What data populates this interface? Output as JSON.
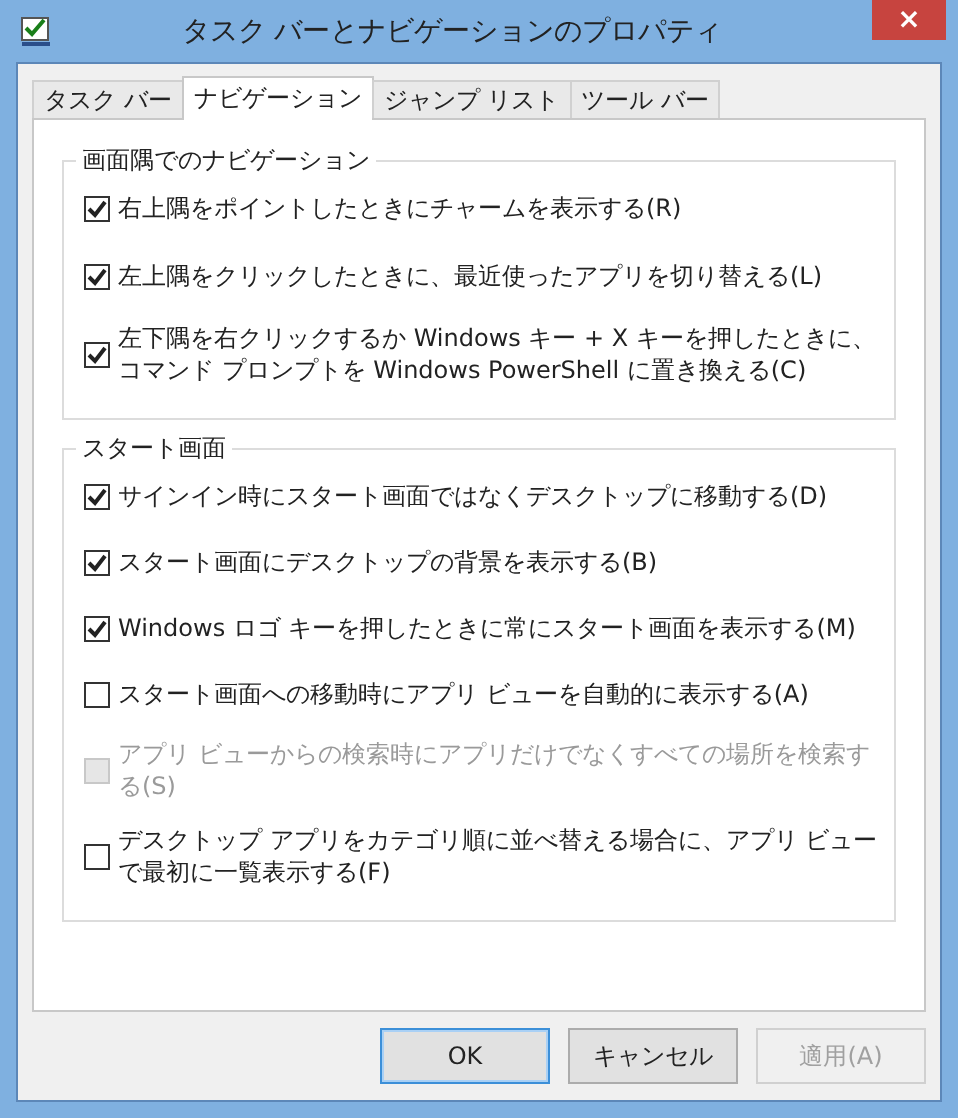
{
  "window": {
    "title": "タスク バーとナビゲーションのプロパティ",
    "close": "×"
  },
  "tabs": [
    {
      "label": "タスク バー",
      "selected": false
    },
    {
      "label": "ナビゲーション",
      "selected": true
    },
    {
      "label": "ジャンプ リスト",
      "selected": false
    },
    {
      "label": "ツール バー",
      "selected": false
    }
  ],
  "groups": [
    {
      "title": "画面隅でのナビゲーション",
      "options": [
        {
          "label": "右上隅をポイントしたときにチャームを表示する(R)",
          "checked": true,
          "disabled": false
        },
        {
          "label": "左上隅をクリックしたときに、最近使ったアプリを切り替える(L)",
          "checked": true,
          "disabled": false
        },
        {
          "label": "左下隅を右クリックするか Windows キー + X キーを押したときに、コマンド プロンプトを Windows PowerShell に置き換える(C)",
          "checked": true,
          "disabled": false
        }
      ]
    },
    {
      "title": "スタート画面",
      "options": [
        {
          "label": "サインイン時にスタート画面ではなくデスクトップに移動する(D)",
          "checked": true,
          "disabled": false
        },
        {
          "label": "スタート画面にデスクトップの背景を表示する(B)",
          "checked": true,
          "disabled": false
        },
        {
          "label": "Windows ロゴ キーを押したときに常にスタート画面を表示する(M)",
          "checked": true,
          "disabled": false
        },
        {
          "label": "スタート画面への移動時にアプリ ビューを自動的に表示する(A)",
          "checked": false,
          "disabled": false
        },
        {
          "label": "アプリ ビューからの検索時にアプリだけでなくすべての場所を検索する(S)",
          "checked": false,
          "disabled": true
        },
        {
          "label": "デスクトップ アプリをカテゴリ順に並べ替える場合に、アプリ ビューで最初に一覧表示する(F)",
          "checked": false,
          "disabled": false
        }
      ]
    }
  ],
  "buttons": [
    {
      "label": "OK",
      "default": true,
      "disabled": false
    },
    {
      "label": "キャンセル",
      "default": false,
      "disabled": false
    },
    {
      "label": "適用(A)",
      "default": false,
      "disabled": true
    }
  ]
}
